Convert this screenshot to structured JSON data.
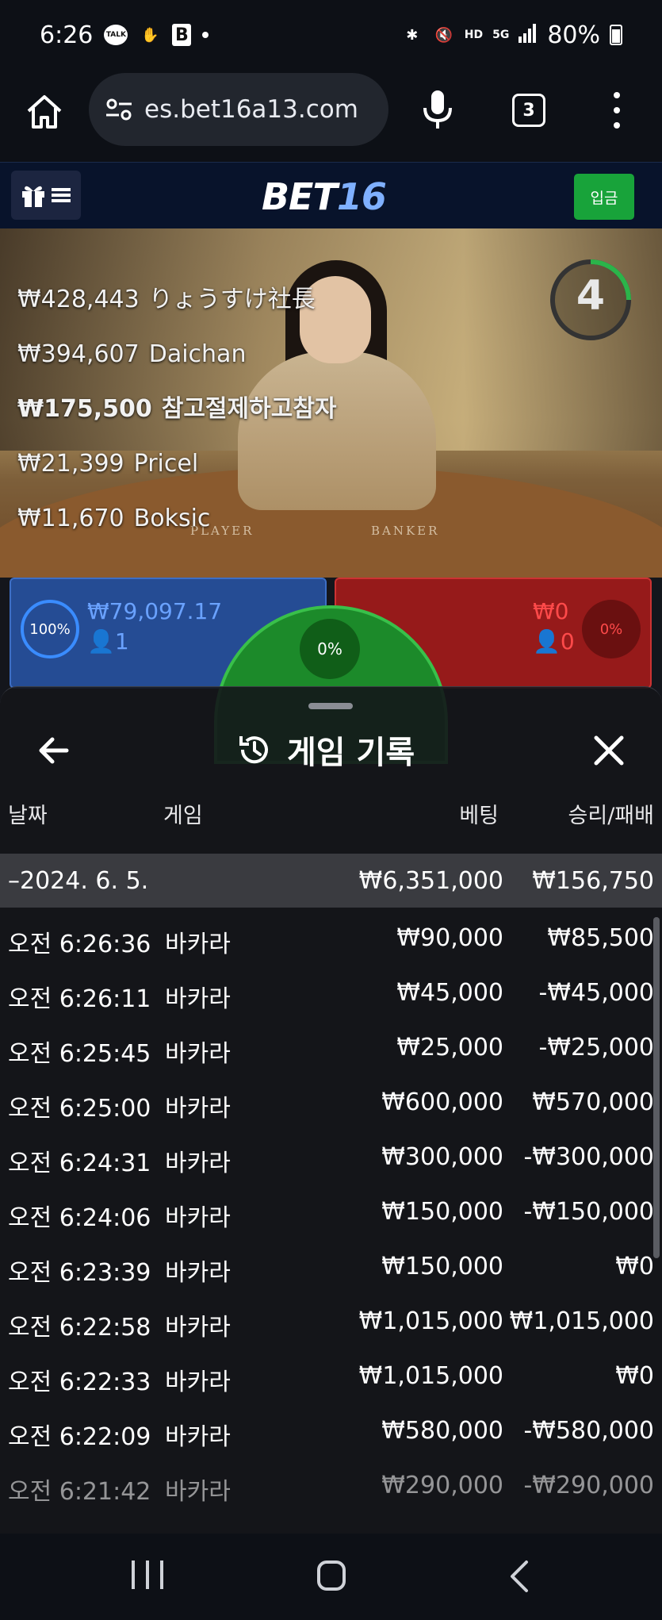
{
  "status_bar": {
    "time": "6:26",
    "battery": "80%",
    "net_label": "HD",
    "sig_label": "5G",
    "talk_label": "TALK",
    "b_label": "B"
  },
  "browser": {
    "url": "es.bet16a13.com",
    "tab_count": "3"
  },
  "site_header": {
    "logo_part1": "BET",
    "logo_part2": "16",
    "deposit_label": "입금"
  },
  "video": {
    "timer": "4",
    "player_label": "PLAYER",
    "banker_label": "BANKER",
    "leaderboard": [
      {
        "amount": "₩428,443",
        "name": "りょうすけ社長",
        "bold": false
      },
      {
        "amount": "₩394,607",
        "name": "Daichan",
        "bold": false
      },
      {
        "amount": "₩175,500",
        "name": "참고절제하고참자",
        "bold": true
      },
      {
        "amount": "₩21,399",
        "name": "Pricel",
        "bold": false
      },
      {
        "amount": "₩11,670",
        "name": "Boksic",
        "bold": false
      }
    ]
  },
  "bet_area": {
    "player_pct": "100%",
    "player_amount": "₩79,097.17",
    "player_count": "1",
    "banker_pct": "0%",
    "banker_amount": "₩0",
    "banker_count": "0",
    "tie_pct": "0%"
  },
  "popup": {
    "title": "게임 기록",
    "columns": {
      "date": "날짜",
      "game": "게임",
      "bet": "베팅",
      "result": "승리/패배"
    },
    "summary": {
      "date": "–2024. 6. 5.",
      "bet": "₩6,351,000",
      "result": "₩156,750"
    },
    "rows": [
      {
        "time": "오전 6:26:36",
        "game": "바카라",
        "bet": "₩90,000",
        "result": "₩85,500"
      },
      {
        "time": "오전 6:26:11",
        "game": "바카라",
        "bet": "₩45,000",
        "result": "-₩45,000"
      },
      {
        "time": "오전 6:25:45",
        "game": "바카라",
        "bet": "₩25,000",
        "result": "-₩25,000"
      },
      {
        "time": "오전 6:25:00",
        "game": "바카라",
        "bet": "₩600,000",
        "result": "₩570,000"
      },
      {
        "time": "오전 6:24:31",
        "game": "바카라",
        "bet": "₩300,000",
        "result": "-₩300,000"
      },
      {
        "time": "오전 6:24:06",
        "game": "바카라",
        "bet": "₩150,000",
        "result": "-₩150,000"
      },
      {
        "time": "오전 6:23:39",
        "game": "바카라",
        "bet": "₩150,000",
        "result": "₩0"
      },
      {
        "time": "오전 6:22:58",
        "game": "바카라",
        "bet": "₩1,015,000",
        "result": "₩1,015,000"
      },
      {
        "time": "오전 6:22:33",
        "game": "바카라",
        "bet": "₩1,015,000",
        "result": "₩0"
      },
      {
        "time": "오전 6:22:09",
        "game": "바카라",
        "bet": "₩580,000",
        "result": "-₩580,000"
      },
      {
        "time": "오전 6:21:42",
        "game": "바카라",
        "bet": "₩290,000",
        "result": "-₩290,000"
      }
    ]
  },
  "colors": {
    "player_blue": "#254c94",
    "banker_red": "#961a1a",
    "tie_green": "#1c8a2a",
    "deposit_green": "#18a33a",
    "header_navy": "#08132b"
  }
}
